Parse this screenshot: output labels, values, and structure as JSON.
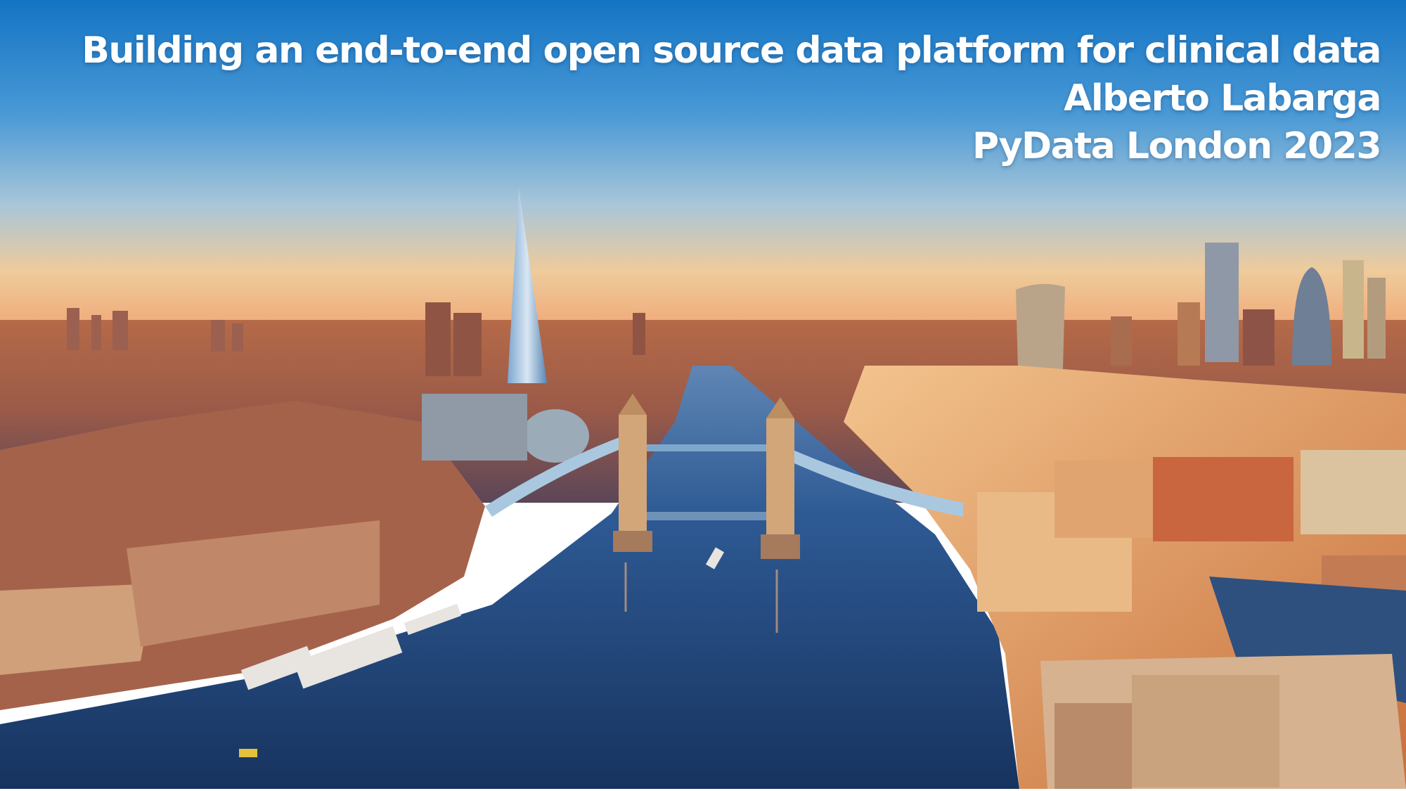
{
  "slide": {
    "title": "Building an end-to-end open source data platform for clinical data",
    "author": "Alberto Labarga",
    "event": "PyData London 2023"
  },
  "background": {
    "description_icon": "london-skyline-photo",
    "sky_top": "#1a78c8",
    "sky_horizon": "#f2c48e",
    "river": "#1c3f78",
    "buildings_warm": "#c8703c"
  }
}
